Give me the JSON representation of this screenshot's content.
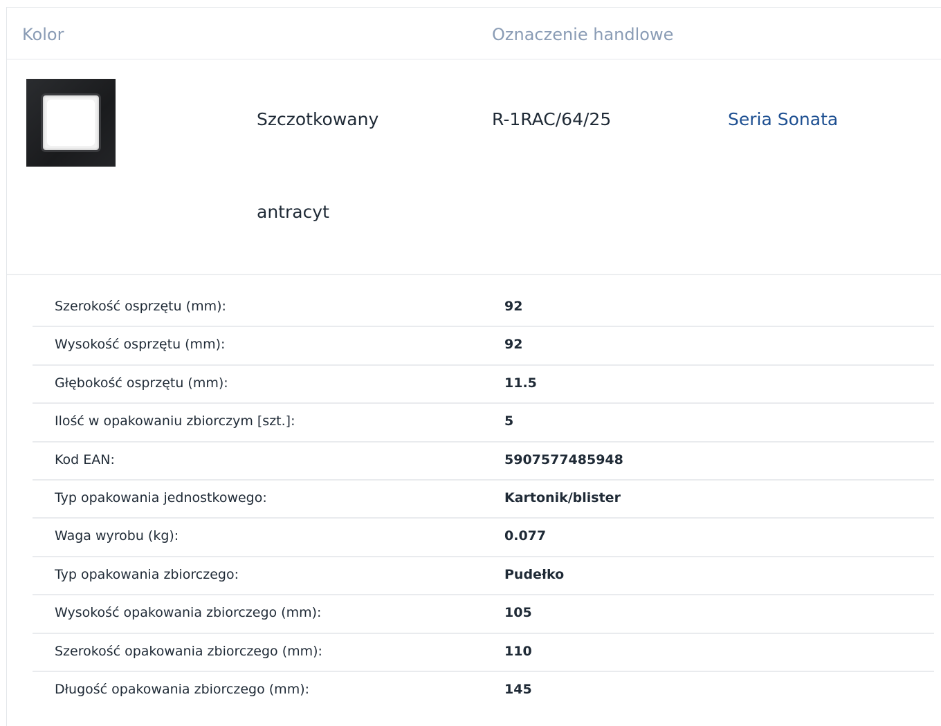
{
  "header": {
    "color_label": "Kolor",
    "trade_label": "Oznaczenie handlowe"
  },
  "product": {
    "color_line1": "Szczotkowany",
    "color_line2": "antracyt",
    "trade_code": "R-1RAC/64/25",
    "series_link": "Seria Sonata"
  },
  "specs": [
    {
      "label": "Szerokość osprzętu (mm):",
      "value": "92"
    },
    {
      "label": "Wysokość osprzętu (mm):",
      "value": "92"
    },
    {
      "label": "Głębokość osprzętu (mm):",
      "value": "11.5"
    },
    {
      "label": "Ilość w opakowaniu zbiorczym [szt.]:",
      "value": "5"
    },
    {
      "label": "Kod EAN:",
      "value": "5907577485948"
    },
    {
      "label": "Typ opakowania jednostkowego:",
      "value": "Kartonik/blister"
    },
    {
      "label": "Waga wyrobu (kg):",
      "value": "0.077"
    },
    {
      "label": "Typ opakowania zbiorczego:",
      "value": "Pudełko"
    },
    {
      "label": "Wysokość opakowania zbiorczego (mm):",
      "value": "105"
    },
    {
      "label": "Szerokość opakowania zbiorczego (mm):",
      "value": "110"
    },
    {
      "label": "Długość opakowania zbiorczego (mm):",
      "value": "145"
    }
  ]
}
